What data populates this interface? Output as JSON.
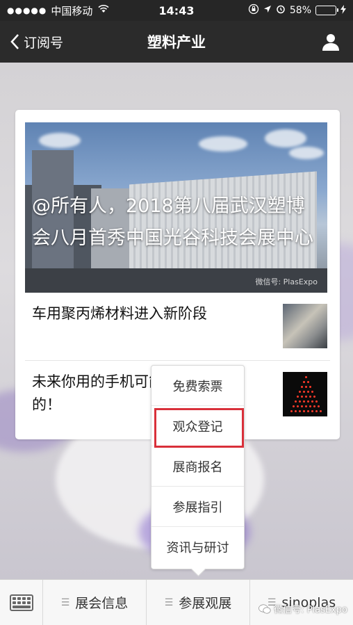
{
  "status_bar": {
    "signal": "●●●●●",
    "carrier": "中国移动",
    "time": "14:43",
    "battery": "58%",
    "battery_level": 0.58,
    "icons": [
      "wifi-icon",
      "rotation-lock-icon",
      "location-icon",
      "alarm-icon",
      "battery-icon",
      "charging-icon"
    ]
  },
  "navbar": {
    "back_label": "订阅号",
    "title": "塑料产业",
    "icons": [
      "chevron-left-icon",
      "user-icon"
    ]
  },
  "card": {
    "hero_title": "@所有人，2018第八届武汉塑博会八月首秀中国光谷科技会展中心",
    "hero_watermark": "微信号: PlasExpo",
    "items": [
      {
        "title": "车用聚丙烯材料进入新阶段"
      },
      {
        "title": "未来你用的手机可能是细菌生产的！"
      }
    ]
  },
  "popup_menu": {
    "items": [
      "免费索票",
      "观众登记",
      "展商报名",
      "参展指引",
      "资讯与研讨"
    ],
    "highlighted": "观众登记"
  },
  "bottom_menu": {
    "items": [
      "展会信息",
      "参展观展",
      "sinoplas"
    ],
    "icons": [
      "keyboard-icon",
      "menu-lines-icon"
    ]
  },
  "watermark": "微信号: PlasExpo",
  "colors": {
    "navbar": "#2b2b2b",
    "highlight": "#d9303a",
    "battery": "#4cd964"
  }
}
